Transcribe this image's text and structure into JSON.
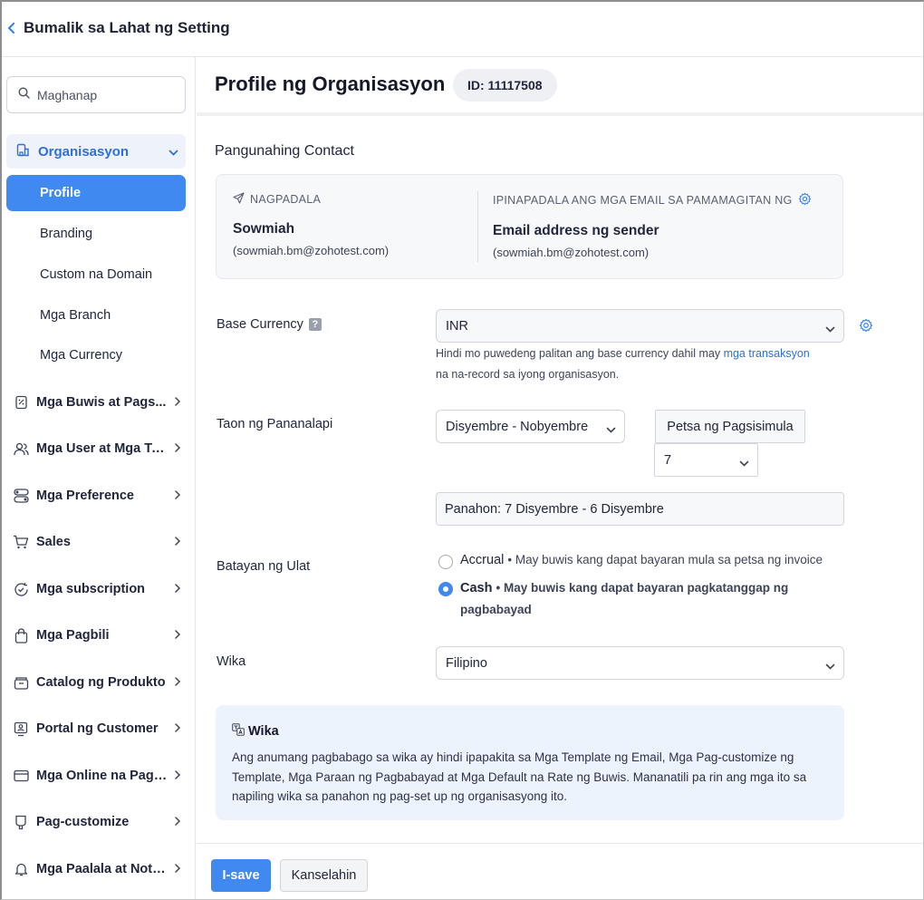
{
  "header": {
    "back_label": "Bumalik sa Lahat ng Setting"
  },
  "sidebar": {
    "search_placeholder": "Maghanap",
    "org_label": "Organisasyon",
    "sub_items": [
      "Profile",
      "Branding",
      "Custom na Domain",
      "Mga Branch",
      "Mga Currency"
    ],
    "active_sub_item": "Profile",
    "items": [
      "Mga Buwis at Pags...",
      "Mga User at Mga Tu...",
      "Mga Preference",
      "Sales",
      "Mga subscription",
      "Mga Pagbili",
      "Catalog ng Produkto",
      "Portal ng Customer",
      "Mga Online na Pagb...",
      "Pag-customize",
      "Mga Paalala at Notif..."
    ]
  },
  "main": {
    "title": "Profile ng Organisasyon",
    "id_badge": "ID: 11117508",
    "primary_contact": {
      "heading": "Pangunahing Contact",
      "sender_head": "NAGPADALA",
      "sender_name": "Sowmiah",
      "sender_email": "(sowmiah.bm@zohotest.com)",
      "via_head": "IPINAPADALA ANG MGA EMAIL SA PAMAMAGITAN NG",
      "via_name": "Email address ng sender",
      "via_email": "(sowmiah.bm@zohotest.com)"
    },
    "base_currency": {
      "label": "Base Currency",
      "help": "?",
      "value": "INR",
      "hint_before": "Hindi mo puwedeng palitan ang base currency dahil may ",
      "hint_link": "mga transaksyon",
      "hint_after": "na na-record sa iyong organisasyon."
    },
    "fiscal_year": {
      "label": "Taon ng Pananalapi",
      "value": "Disyembre - Nobyembre",
      "start_date_label": "Petsa ng Pagsisimula",
      "start_day": "7",
      "period": "Panahon: 7 Disyembre - 6 Disyembre"
    },
    "report_basis": {
      "label": "Batayan ng Ulat",
      "selected": "Cash",
      "options": [
        {
          "name": "Accrual",
          "desc": "• May buwis kang dapat bayaran mula sa petsa ng invoice"
        },
        {
          "name": "Cash",
          "desc": "• May buwis kang dapat bayaran pagkatanggap ng",
          "desc2": "pagbabayad"
        }
      ]
    },
    "language": {
      "label": "Wika",
      "value": "Filipino"
    },
    "info_box": {
      "title": "Wika",
      "lines": [
        "Ang anumang pagbabago sa wika ay hindi ipapakita sa Mga Template ng Email, Mga Pag-customize ng",
        "Template, Mga Paraan ng Pagbabayad at Mga Default na Rate ng Buwis. Mananatili pa rin ang mga ito sa",
        "napiling wika sa panahon ng pag-set up ng organisasyong ito."
      ]
    },
    "footer": {
      "save_label": "I-save",
      "cancel_label": "Kanselahin"
    }
  },
  "colors": {
    "accent": "#4089f0",
    "link": "#2f6fdb",
    "info_bg": "#edf3fd"
  },
  "icons": [
    "chevron-left-icon",
    "search-icon",
    "building-icon",
    "chevron-down-icon",
    "chevron-right-icon",
    "send-icon",
    "gear-icon",
    "translate-icon"
  ]
}
